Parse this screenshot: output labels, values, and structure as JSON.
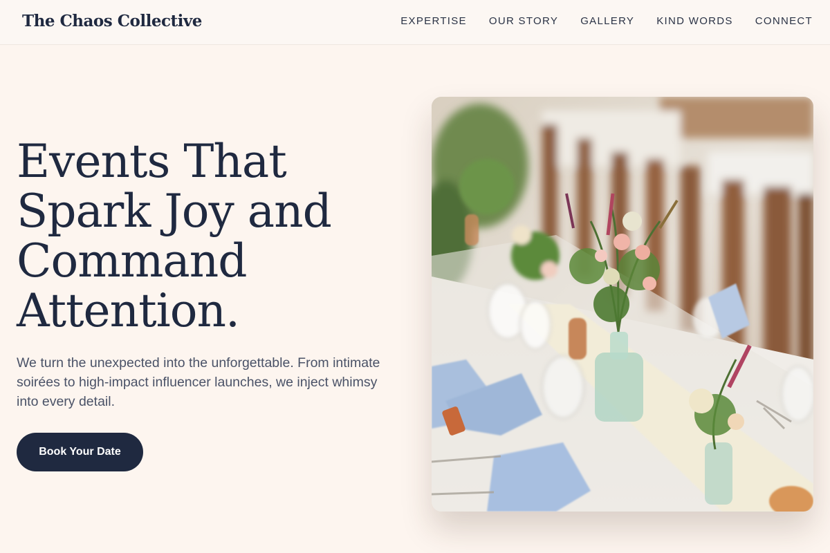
{
  "header": {
    "logo": "The Chaos Collective",
    "nav": [
      {
        "label": "EXPERTISE"
      },
      {
        "label": "OUR STORY"
      },
      {
        "label": "GALLERY"
      },
      {
        "label": "KIND WORDS"
      },
      {
        "label": "CONNECT"
      }
    ]
  },
  "hero": {
    "title_lines": [
      "Events That",
      "Spark Joy and",
      "Command",
      "Attention."
    ],
    "subtitle": "We turn the unexpected into the unforgettable. From intimate soirées to high-impact influencer launches, we inject whimsy into every detail.",
    "cta_label": "Book Your Date"
  },
  "image": {
    "description_icon": "photo-event-table"
  },
  "colors": {
    "background": "#fdf5ef",
    "primary": "#1f2940",
    "text_muted": "#4a5267"
  }
}
